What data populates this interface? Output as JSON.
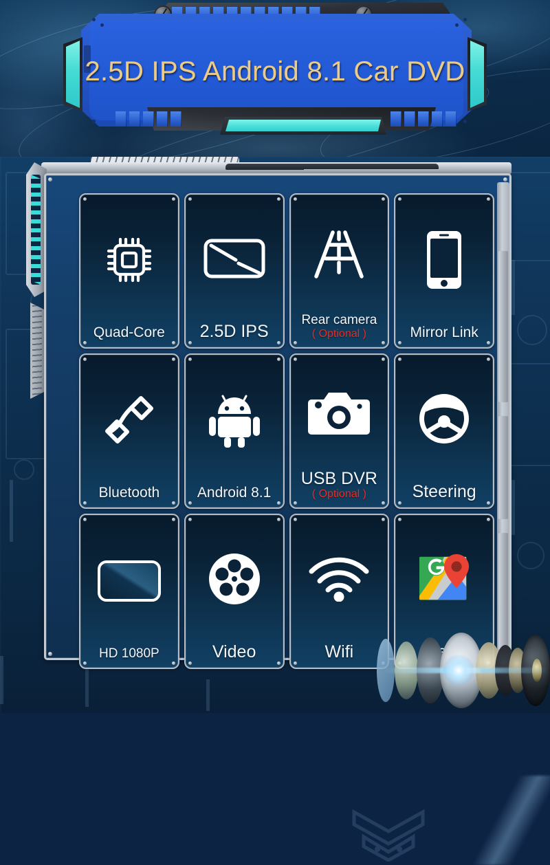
{
  "banner": {
    "title": "2.5D IPS Android 8.1 Car DVD",
    "title_color": "#eccb87",
    "frame_color": "#2456c9",
    "accent_color": "#4fe0da"
  },
  "device": {
    "panel_border_color": "#c3cad2",
    "panel_bg_color": "#143e69"
  },
  "features": {
    "optional_note": "( Optional )",
    "optional_color": "#ef2a1e",
    "label_color": "#f2f6fa",
    "tiles": [
      {
        "label": "Quad-Core",
        "icon": "cpu-chip-icon",
        "optional": false,
        "size": "sm"
      },
      {
        "label": "2.5D IPS",
        "icon": "curved-screen-icon",
        "optional": false,
        "size": "md"
      },
      {
        "label": "Rear camera",
        "icon": "road-lanes-icon",
        "optional": true,
        "size": "xs"
      },
      {
        "label": "Mirror Link",
        "icon": "smartphone-icon",
        "optional": false,
        "size": "sm"
      },
      {
        "label": "Bluetooth",
        "icon": "phone-handset-icon",
        "optional": false,
        "size": "sm"
      },
      {
        "label": "Android 8.1",
        "icon": "android-robot-icon",
        "optional": false,
        "size": "sm"
      },
      {
        "label": "USB DVR",
        "icon": "camera-icon",
        "optional": true,
        "size": "md"
      },
      {
        "label": "Steering",
        "icon": "steering-wheel-icon",
        "optional": false,
        "size": "md"
      },
      {
        "label": "HD 1080P",
        "icon": "display-screen-icon",
        "optional": false,
        "size": "xs"
      },
      {
        "label": "Video",
        "icon": "film-reel-icon",
        "optional": false,
        "size": "md"
      },
      {
        "label": "Wifi",
        "icon": "wifi-icon",
        "optional": false,
        "size": "md"
      },
      {
        "label": "Maps",
        "icon": "google-maps-icon",
        "optional": false,
        "size": "md"
      }
    ]
  },
  "decor": {
    "speaker_graphic": "exploded-speaker-assembly",
    "background": "underwater-tech-background"
  }
}
